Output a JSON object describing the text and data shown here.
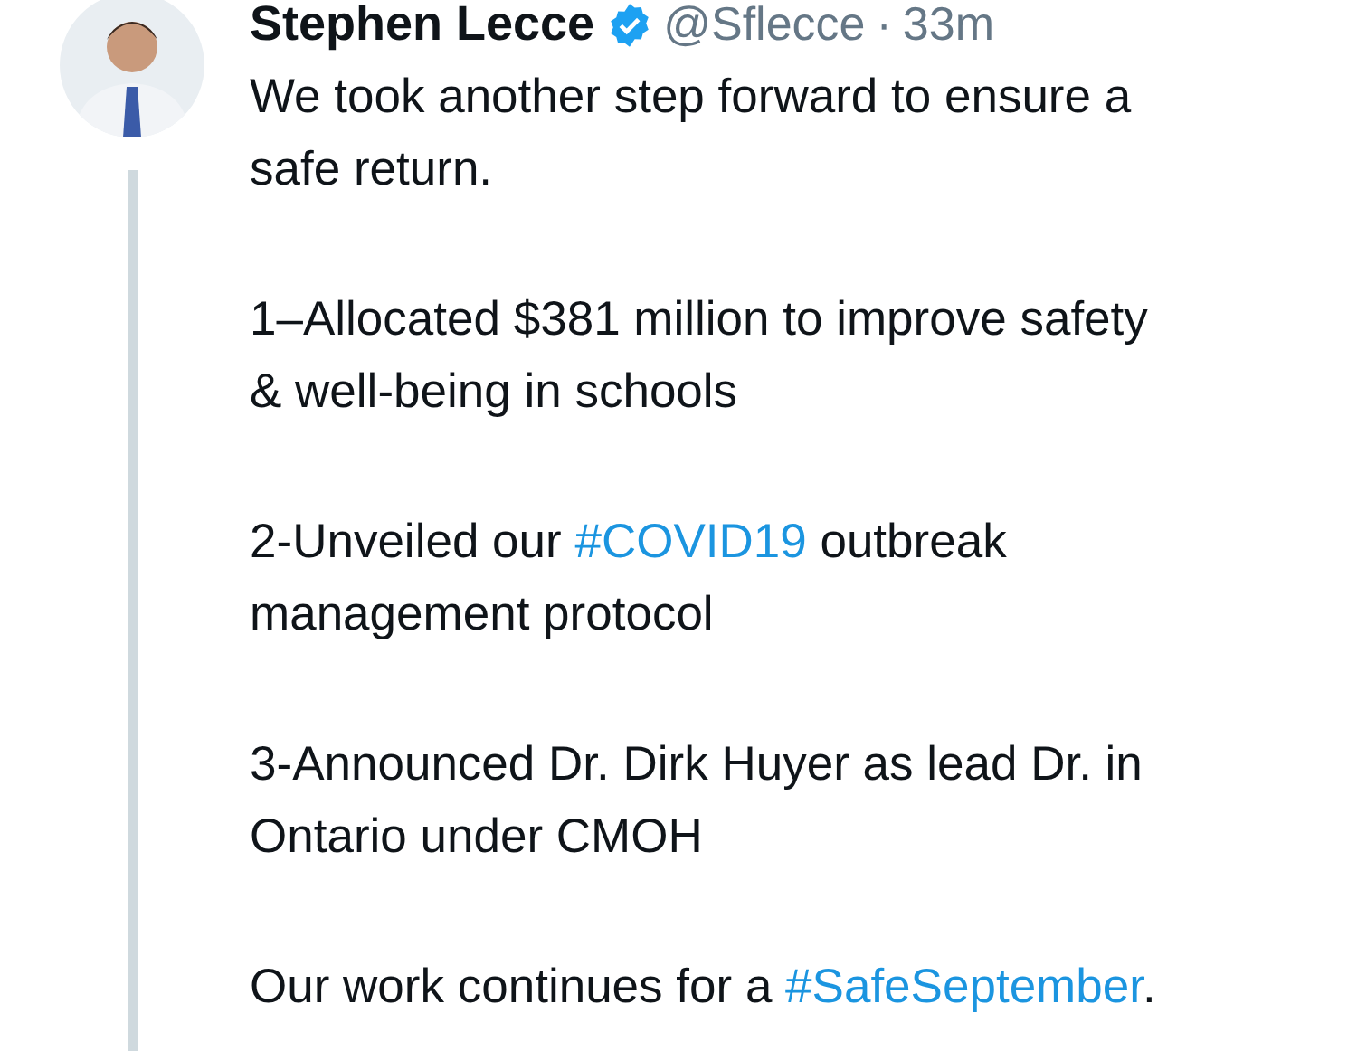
{
  "tweet": {
    "author": {
      "name": "Stephen Lecce",
      "verified": true,
      "handle": "@Sflecce",
      "separator": "·",
      "time": "33m"
    },
    "paragraphs": [
      [
        [
          {
            "kind": "text",
            "text": "We took another step forward to ensure a"
          }
        ],
        [
          {
            "kind": "text",
            "text": "safe return."
          }
        ]
      ],
      [
        [
          {
            "kind": "text",
            "text": "1–Allocated $381 million to improve safety"
          }
        ],
        [
          {
            "kind": "text",
            "text": "& well-being in schools"
          }
        ]
      ],
      [
        [
          {
            "kind": "text",
            "text": "2-Unveiled our "
          },
          {
            "kind": "hashtag",
            "text": "#COVID19"
          },
          {
            "kind": "text",
            "text": " outbreak"
          }
        ],
        [
          {
            "kind": "text",
            "text": "management protocol"
          }
        ]
      ],
      [
        [
          {
            "kind": "text",
            "text": "3-Announced Dr. Dirk Huyer as lead Dr. in"
          }
        ],
        [
          {
            "kind": "text",
            "text": "Ontario under CMOH"
          }
        ]
      ],
      [
        [
          {
            "kind": "text",
            "text": "Our work continues for a "
          },
          {
            "kind": "hashtag",
            "text": "#SafeSeptember"
          },
          {
            "kind": "text",
            "text": "."
          }
        ]
      ]
    ]
  }
}
